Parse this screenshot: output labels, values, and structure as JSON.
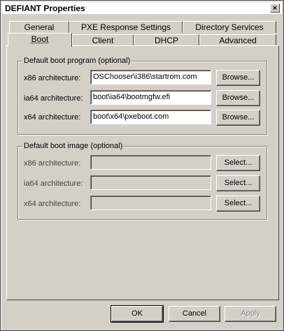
{
  "window": {
    "title": "DEFIANT Properties",
    "close_glyph": "×"
  },
  "tabs": {
    "row1": [
      "General",
      "PXE Response Settings",
      "Directory Services"
    ],
    "row2": [
      "Boot",
      "Client",
      "DHCP",
      "Advanced"
    ]
  },
  "boot_program": {
    "title": "Default boot program (optional)",
    "rows": [
      {
        "label": "x86 architecture:",
        "value": "OSChooser\\i386\\startrom.com",
        "button": "Browse..."
      },
      {
        "label": "ia64 architecture:",
        "value": "boot\\ia64\\bootmgfw.efi",
        "button": "Browse..."
      },
      {
        "label": "x64 architecture:",
        "value": "boot\\x64\\pxeboot.com",
        "button": "Browse..."
      }
    ]
  },
  "boot_image": {
    "title": "Default boot image (optional)",
    "rows": [
      {
        "label": "x86 architecture:",
        "value": "",
        "button": "Select..."
      },
      {
        "label": "ia64 architecture:",
        "value": "",
        "button": "Select..."
      },
      {
        "label": "x64 architecture:",
        "value": "",
        "button": "Select..."
      }
    ]
  },
  "footer": {
    "ok": "OK",
    "cancel": "Cancel",
    "apply": "Apply"
  }
}
